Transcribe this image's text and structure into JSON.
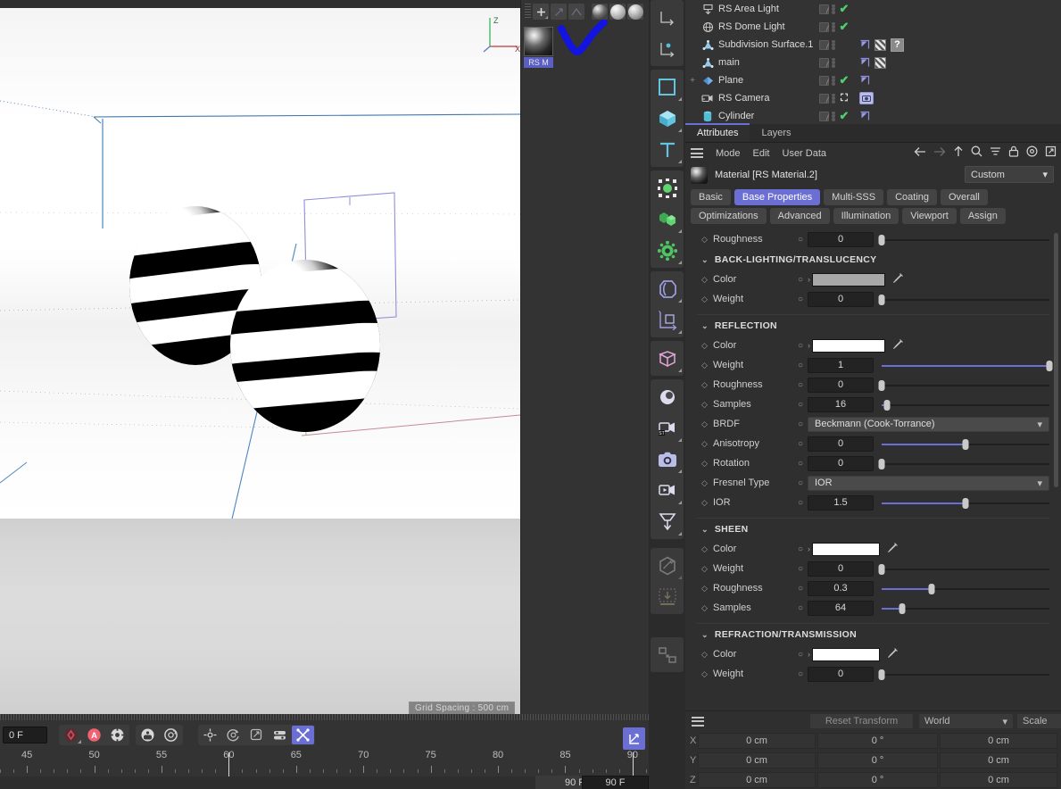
{
  "viewport": {
    "grid_spacing_label": "Grid Spacing : 500 cm",
    "axis_labels": {
      "z": "Z",
      "x": "X"
    },
    "display_buttons": [
      "list-view-icon",
      "grid-view-icon",
      "single-view-icon"
    ]
  },
  "material_manager": {
    "toolbar": [
      "create-material-icon",
      "apply-material-icon",
      "import-material-icon",
      "preview-sphere-1-icon",
      "preview-sphere-2-icon",
      "preview-sphere-3-icon"
    ],
    "materials": [
      {
        "name": "RS M"
      }
    ]
  },
  "rail": {
    "items": [
      {
        "name": "axis-move-icon"
      },
      {
        "name": "workplane-icon"
      },
      {
        "name": "spline-rect-icon"
      },
      {
        "name": "cube-primitive-icon"
      },
      {
        "name": "text-tool-icon"
      },
      {
        "name": "null-object-icon"
      },
      {
        "name": "array-clone-icon"
      },
      {
        "name": "gear-generator-icon"
      },
      {
        "name": "deformer-bend-icon"
      },
      {
        "name": "coordinate-cube-icon"
      },
      {
        "name": "cloth-deform-icon"
      },
      {
        "name": "light-sphere-icon"
      },
      {
        "name": "stage-camera-icon"
      },
      {
        "name": "camera-icon"
      },
      {
        "name": "motion-camera-icon"
      },
      {
        "name": "light-spot-icon"
      },
      {
        "name": "paint-hex-icon"
      },
      {
        "name": "bake-down-icon"
      },
      {
        "name": "xpresso-icon"
      }
    ]
  },
  "object_manager": {
    "rows": [
      {
        "name": "RS Area Light",
        "icon": "area-light-icon",
        "tree": "",
        "checkbox": true,
        "visible_check": true,
        "tags": []
      },
      {
        "name": "RS Dome Light",
        "icon": "dome-light-icon",
        "tree": "",
        "checkbox": true,
        "visible_check": true,
        "tags": []
      },
      {
        "name": "Subdivision Surface.1",
        "icon": "subdivision-icon",
        "tree": "",
        "checkbox": true,
        "visible_check": false,
        "tags": [
          "flag",
          "checker",
          "question"
        ]
      },
      {
        "name": "main",
        "icon": "subdivision-icon",
        "tree": "",
        "checkbox": true,
        "visible_check": false,
        "tags": [
          "flag",
          "checker"
        ]
      },
      {
        "name": "Plane",
        "icon": "plane-icon",
        "tree": "+",
        "checkbox": true,
        "visible_check": true,
        "tags": [
          "flag"
        ]
      },
      {
        "name": "RS Camera",
        "icon": "camera-obj-icon",
        "tree": "",
        "checkbox": true,
        "visible_check": false,
        "tags": [
          "camera"
        ]
      },
      {
        "name": "Cylinder",
        "icon": "cylinder-icon",
        "tree": "",
        "checkbox": true,
        "visible_check": true,
        "tags": [
          "flag"
        ]
      }
    ]
  },
  "attributes": {
    "tabs": [
      {
        "label": "Attributes",
        "active": true
      },
      {
        "label": "Layers",
        "active": false
      }
    ],
    "menu": [
      "Mode",
      "Edit",
      "User Data"
    ],
    "toolbar_icons": [
      "back-arrow-icon",
      "forward-arrow-icon",
      "up-arrow-icon",
      "search-icon",
      "filter-icon",
      "lock-icon",
      "target-icon",
      "external-link-icon"
    ],
    "title": "Material [RS Material.2]",
    "preset_dropdown": "Custom",
    "pills_row1": [
      {
        "label": "Basic",
        "active": false
      },
      {
        "label": "Base Properties",
        "active": true
      },
      {
        "label": "Multi-SSS",
        "active": false
      },
      {
        "label": "Coating",
        "active": false
      },
      {
        "label": "Overall",
        "active": false
      }
    ],
    "pills_row2": [
      {
        "label": "Optimizations",
        "active": false
      },
      {
        "label": "Advanced",
        "active": false
      },
      {
        "label": "Illumination",
        "active": false
      },
      {
        "label": "Viewport",
        "active": false
      },
      {
        "label": "Assign",
        "active": false
      }
    ]
  },
  "params": {
    "top_row": {
      "label": "Roughness",
      "value": "0",
      "slider": 0.0
    },
    "sections": [
      {
        "title": "BACK-LIGHTING/TRANSLUCENCY",
        "rows": [
          {
            "label": "Color",
            "type": "color",
            "swatch": "#a8a8a8",
            "swatch_width": 82
          },
          {
            "label": "Weight",
            "type": "slider",
            "value": "0",
            "slider": 0.0
          }
        ]
      },
      {
        "title": "REFLECTION",
        "rows": [
          {
            "label": "Color",
            "type": "color",
            "swatch": "#ffffff",
            "swatch_width": 82
          },
          {
            "label": "Weight",
            "type": "slider",
            "value": "1",
            "slider": 1.0
          },
          {
            "label": "Roughness",
            "type": "slider",
            "value": "0",
            "slider": 0.0
          },
          {
            "label": "Samples",
            "type": "slider",
            "value": "16",
            "slider": 0.03
          },
          {
            "label": "BRDF",
            "type": "dropdown",
            "value": "Beckmann (Cook-Torrance)"
          },
          {
            "label": "Anisotropy",
            "type": "slider",
            "value": "0",
            "slider": 0.5
          },
          {
            "label": "Rotation",
            "type": "slider",
            "value": "0",
            "slider": 0.0
          },
          {
            "label": "Fresnel Type",
            "type": "dropdown",
            "value": "IOR"
          },
          {
            "label": "IOR",
            "type": "slider",
            "value": "1.5",
            "slider": 0.5
          }
        ]
      },
      {
        "title": "SHEEN",
        "rows": [
          {
            "label": "Color",
            "type": "color",
            "swatch": "#ffffff",
            "swatch_width": 76
          },
          {
            "label": "Weight",
            "type": "slider",
            "value": "0",
            "slider": 0.0
          },
          {
            "label": "Roughness",
            "type": "slider",
            "value": "0.3",
            "slider": 0.3
          },
          {
            "label": "Samples",
            "type": "slider",
            "value": "64",
            "slider": 0.12
          }
        ]
      },
      {
        "title": "REFRACTION/TRANSMISSION",
        "rows": [
          {
            "label": "Color",
            "type": "color",
            "swatch": "#ffffff",
            "swatch_width": 76
          },
          {
            "label": "Weight",
            "type": "slider",
            "value": "0",
            "slider": 0.0
          }
        ]
      }
    ]
  },
  "coordinates": {
    "reset_label": "Reset Transform",
    "space_dropdown": "World",
    "mode_dropdown": "Scale",
    "rows": [
      {
        "axis": "X",
        "position": "0 cm",
        "rotation": "0 °",
        "scale": "0 cm"
      },
      {
        "axis": "Y",
        "position": "0 cm",
        "rotation": "0 °",
        "scale": "0 cm"
      },
      {
        "axis": "Z",
        "position": "0 cm",
        "rotation": "0 °",
        "scale": "0 cm"
      }
    ]
  },
  "timeline": {
    "current_frame": "0 F",
    "end_frame_a": "90 F",
    "end_frame_b": "90 F",
    "ruler_labels": [
      "45",
      "50",
      "55",
      "60",
      "65",
      "70",
      "75",
      "80",
      "85",
      "90"
    ],
    "ruler_values": [
      45,
      50,
      55,
      60,
      65,
      70,
      75,
      80,
      85,
      90
    ],
    "playhead_frame": 60,
    "buttons_group1": [
      "record-keyframe-icon",
      "autokey-icon",
      "keyframe-settings-icon"
    ],
    "buttons_group2": [
      "position-key-icon",
      "rotation-key-icon"
    ],
    "buttons_group3": [
      "move-axis-icon",
      "rotate-axis-icon",
      "scale-axis-icon",
      "parameter-key-icon",
      "point-level-anim-icon"
    ],
    "curve_button": "animation-curve-icon"
  },
  "colors": {
    "accent": "#6b6fd4",
    "panel_bg": "#2f2f2f",
    "dark_bg": "#2b2b2b",
    "row_bg": "#333333",
    "green_check": "#4fd06a",
    "annotation_blue": "#1414e0",
    "record_red": "#f06272"
  }
}
